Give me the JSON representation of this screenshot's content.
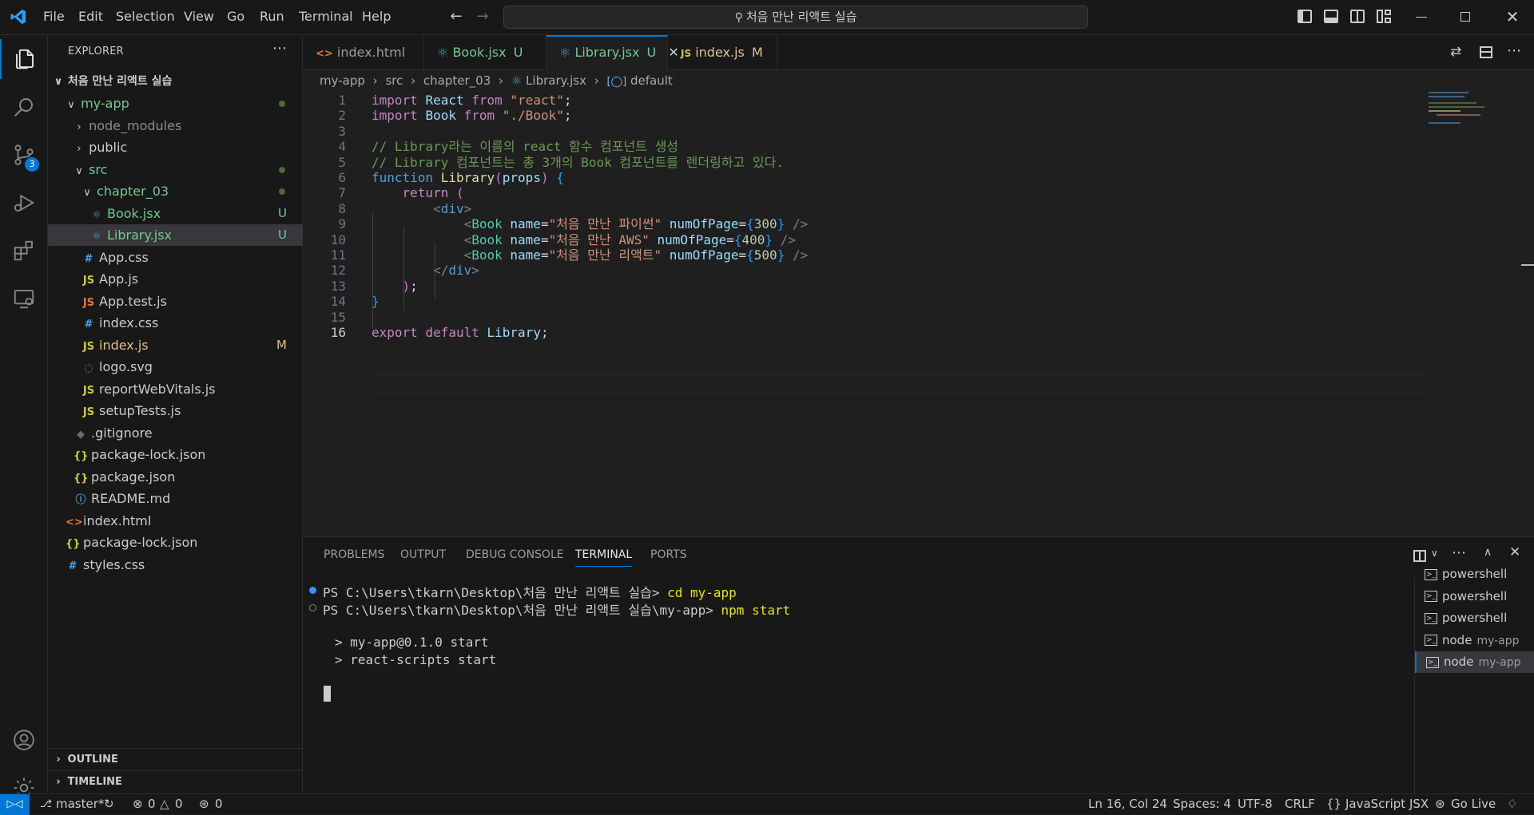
{
  "titlebar": {
    "menu": [
      "File",
      "Edit",
      "Selection",
      "View",
      "Go",
      "Run",
      "Terminal",
      "Help"
    ],
    "search": "처음 만난 리액트 실습"
  },
  "explorer": {
    "title": "EXPLORER",
    "root": "처음 만난 리액트 실습",
    "items": [
      {
        "label": "my-app",
        "kind": "folder-open",
        "status": "dot",
        "color": "#73c991"
      },
      {
        "label": "node_modules",
        "kind": "folder",
        "color": "#8b8b8b"
      },
      {
        "label": "public",
        "kind": "folder",
        "color": "#cccccc"
      },
      {
        "label": "src",
        "kind": "folder-open",
        "status": "dot",
        "color": "#73c991"
      },
      {
        "label": "chapter_03",
        "kind": "folder-open",
        "status": "dot",
        "color": "#73c991"
      },
      {
        "label": "Book.jsx",
        "kind": "react",
        "status": "U",
        "color": "#73c991"
      },
      {
        "label": "Library.jsx",
        "kind": "react",
        "status": "U",
        "color": "#73c991"
      },
      {
        "label": "App.css",
        "kind": "css",
        "color": "#cccccc"
      },
      {
        "label": "App.js",
        "kind": "js",
        "color": "#cccccc"
      },
      {
        "label": "App.test.js",
        "kind": "test",
        "color": "#cccccc"
      },
      {
        "label": "index.css",
        "kind": "css",
        "color": "#cccccc"
      },
      {
        "label": "index.js",
        "kind": "js",
        "status": "M",
        "color": "#e2c08d"
      },
      {
        "label": "logo.svg",
        "kind": "svg",
        "color": "#cccccc"
      },
      {
        "label": "reportWebVitals.js",
        "kind": "js",
        "color": "#cccccc"
      },
      {
        "label": "setupTests.js",
        "kind": "js",
        "color": "#cccccc"
      },
      {
        "label": ".gitignore",
        "kind": "git",
        "color": "#cccccc"
      },
      {
        "label": "package-lock.json",
        "kind": "json",
        "color": "#cccccc"
      },
      {
        "label": "package.json",
        "kind": "json",
        "color": "#cccccc"
      },
      {
        "label": "README.md",
        "kind": "info",
        "color": "#cccccc"
      },
      {
        "label": "index.html",
        "kind": "html",
        "color": "#cccccc"
      },
      {
        "label": "package-lock.json",
        "kind": "json",
        "color": "#cccccc"
      },
      {
        "label": "styles.css",
        "kind": "css",
        "color": "#cccccc"
      }
    ],
    "outline": "OUTLINE",
    "timeline": "TIMELINE"
  },
  "tabs": [
    {
      "label": "index.html",
      "status": "",
      "active": false
    },
    {
      "label": "Book.jsx",
      "status": "U",
      "active": false
    },
    {
      "label": "Library.jsx",
      "status": "U",
      "active": true
    },
    {
      "label": "index.js",
      "status": "M",
      "active": false
    }
  ],
  "breadcrumb": [
    "my-app",
    "src",
    "chapter_03",
    "Library.jsx",
    "default"
  ],
  "code": {
    "line_numbers": [
      "1",
      "2",
      "3",
      "4",
      "5",
      "6",
      "7",
      "8",
      "9",
      "10",
      "11",
      "12",
      "13",
      "14",
      "15",
      "16"
    ],
    "lines": [
      "import React from \"react\";",
      "import Book from \"./Book\";",
      "",
      "// Library라는 이름의 react 함수 컴포넌트 생성",
      "// Library 컴포넌트는 총 3개의 Book 컴포넌트를 렌더링하고 있다.",
      "function Library(props) {",
      "    return (",
      "        <div>",
      "            <Book name=\"처음 만난 파이썬\" numOfPage={300} />",
      "            <Book name=\"처음 만난 AWS\" numOfPage={400} />",
      "            <Book name=\"처음 만난 리액트\" numOfPage={500} />",
      "        </div>",
      "    );",
      "}",
      "",
      "export default Library;"
    ],
    "current_line": "16"
  },
  "panel": {
    "tabs": [
      "PROBLEMS",
      "OUTPUT",
      "DEBUG CONSOLE",
      "TERMINAL",
      "PORTS"
    ],
    "active_tab": "TERMINAL",
    "terminal": [
      {
        "prompt": "PS C:\\Users\\tkarn\\Desktop\\처음 만난 리액트 실습>",
        "cmd": "cd my-app"
      },
      {
        "prompt": "PS C:\\Users\\tkarn\\Desktop\\처음 만난 리액트 실습\\my-app>",
        "cmd": "npm start"
      },
      {
        "prompt": "",
        "cmd": ""
      },
      {
        "prompt": "> my-app@0.1.0 start",
        "cmd": ""
      },
      {
        "prompt": "> react-scripts start",
        "cmd": ""
      }
    ],
    "terminals": [
      {
        "name": "powershell",
        "sub": ""
      },
      {
        "name": "powershell",
        "sub": ""
      },
      {
        "name": "powershell",
        "sub": ""
      },
      {
        "name": "node",
        "sub": "my-app"
      },
      {
        "name": "node",
        "sub": "my-app"
      }
    ]
  },
  "statusbar": {
    "branch": "master*",
    "errors": "0",
    "warnings": "0",
    "ports": "0",
    "position": "Ln 16, Col 24",
    "spaces": "Spaces: 4",
    "encoding": "UTF-8",
    "eol": "CRLF",
    "language": "JavaScript JSX",
    "golive": "Go Live"
  },
  "scm_badge": "3",
  "colors": {
    "accent": "#0078d4",
    "untracked": "#73c991",
    "modified": "#e2c08d"
  }
}
